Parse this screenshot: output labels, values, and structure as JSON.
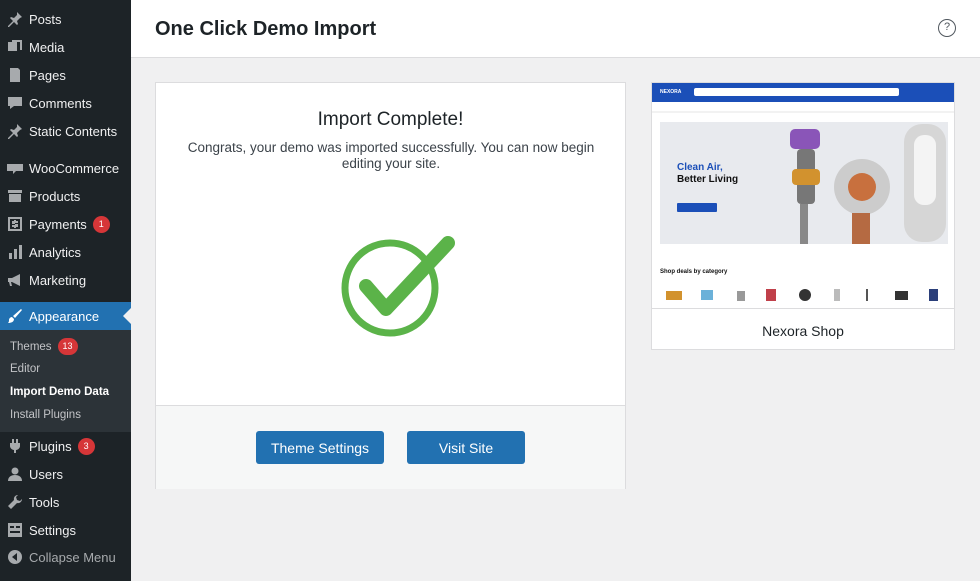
{
  "sidebar": {
    "items": [
      {
        "label": "Posts",
        "icon": "pin-icon"
      },
      {
        "label": "Media",
        "icon": "media-icon"
      },
      {
        "label": "Pages",
        "icon": "pages-icon"
      },
      {
        "label": "Comments",
        "icon": "comment-icon"
      },
      {
        "label": "Static Contents",
        "icon": "pin-icon"
      },
      {
        "label": "WooCommerce",
        "icon": "woo-icon"
      },
      {
        "label": "Products",
        "icon": "archive-icon"
      },
      {
        "label": "Payments",
        "icon": "dollar-icon",
        "badge": "1"
      },
      {
        "label": "Analytics",
        "icon": "chart-icon"
      },
      {
        "label": "Marketing",
        "icon": "megaphone-icon"
      },
      {
        "label": "Appearance",
        "icon": "brush-icon"
      },
      {
        "label": "Plugins",
        "icon": "plug-icon",
        "badge": "3"
      },
      {
        "label": "Users",
        "icon": "user-icon"
      },
      {
        "label": "Tools",
        "icon": "wrench-icon"
      },
      {
        "label": "Settings",
        "icon": "settings-icon"
      },
      {
        "label": "Collapse Menu",
        "icon": "collapse-icon"
      }
    ],
    "submenu": [
      {
        "label": "Themes",
        "badge": "13"
      },
      {
        "label": "Editor"
      },
      {
        "label": "Import Demo Data"
      },
      {
        "label": "Install Plugins"
      }
    ]
  },
  "header": {
    "title": "One Click Demo Import",
    "help": "?"
  },
  "panel": {
    "title": "Import Complete!",
    "message": "Congrats, your demo was imported successfully. You can now begin editing your site.",
    "buttons": {
      "theme_settings": "Theme Settings",
      "visit_site": "Visit Site"
    }
  },
  "preview": {
    "name": "Nexora Shop",
    "logo": "NEXORA",
    "hero_line1": "Clean Air,",
    "hero_line2": "Better Living",
    "section": "Shop deals by category"
  },
  "colors": {
    "accent": "#2271b1",
    "sidebar": "#1d2327",
    "check": "#5bb349",
    "badge": "#d63638"
  }
}
